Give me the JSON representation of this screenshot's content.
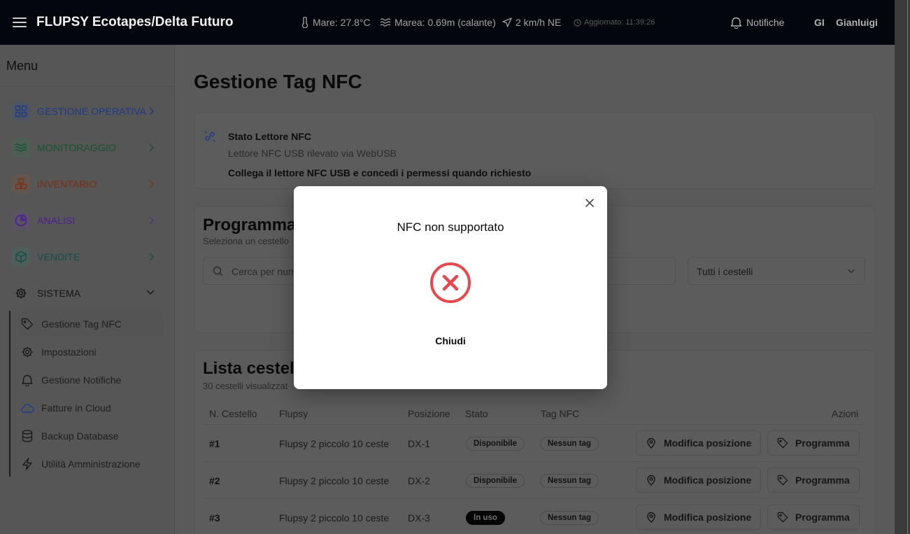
{
  "header": {
    "title": "FLUPSY Ecotapes/Delta Futuro",
    "sea_temp": "Mare: 27.8°C",
    "tide": "Marea: 0.69m (calante)",
    "wind": "2 km/h NE",
    "updated": "Aggiornato: 11:39:26",
    "notifications_label": "Notifiche",
    "user_initials": "GI",
    "user_name": "Gianluigi"
  },
  "sidebar": {
    "title": "Menu",
    "categories": [
      {
        "label": "GESTIONE OPERATIVA",
        "icon": "grid-icon",
        "color": "#1e3a8a",
        "bg": "#4f5662"
      },
      {
        "label": "MONITORAGGIO",
        "icon": "waves-icon",
        "color": "#14532d",
        "bg": "#4f5e55"
      },
      {
        "label": "INVENTARIO",
        "icon": "boxes-icon",
        "color": "#7c2d12",
        "bg": "#625750"
      },
      {
        "label": "ANALISI",
        "icon": "pie-chart-icon",
        "color": "#4c1d95",
        "bg": "#5a5364"
      },
      {
        "label": "VENDITE",
        "icon": "package-icon",
        "color": "#134e4a",
        "bg": "#4f5e5a"
      },
      {
        "label": "SISTEMA",
        "icon": "gear-icon",
        "color": "#151515",
        "bg": "transparent"
      }
    ],
    "sub_items": [
      {
        "label": "Gestione Tag NFC",
        "icon": "tag-icon"
      },
      {
        "label": "Impostazioni",
        "icon": "gear-icon"
      },
      {
        "label": "Gestione Notifiche",
        "icon": "bell-icon"
      },
      {
        "label": "Fatture in Cloud",
        "icon": "cloud-icon"
      },
      {
        "label": "Backup Database",
        "icon": "database-icon"
      },
      {
        "label": "Utilità Amministrazione",
        "icon": "zap-icon"
      }
    ]
  },
  "main": {
    "page_title": "Gestione Tag NFC",
    "nfc_status": {
      "title": "Stato Lettore NFC",
      "subtitle": "Lettore NFC USB rilevato via WebUSB",
      "instruction": "Collega il lettore NFC USB e concedi i permessi quando richiesto"
    },
    "program": {
      "title": "Programma",
      "subtitle": "Seleziona un cestello",
      "search_placeholder": "Cerca per num",
      "filter_value": "Tutti i cestelli"
    },
    "list": {
      "title": "Lista cestelli",
      "subtitle": "30 cestelli visualizzat",
      "columns": [
        "N. Cestello",
        "Flupsy",
        "Posizione",
        "Stato",
        "Tag NFC",
        "Azioni"
      ],
      "rows": [
        {
          "num": "#1",
          "flupsy": "Flupsy 2 piccolo 10 ceste",
          "pos": "DX-1",
          "stato": "Disponibile",
          "tag": "Nessun tag",
          "edit": "Modifica posizione",
          "program": "Programma"
        },
        {
          "num": "#2",
          "flupsy": "Flupsy 2 piccolo 10 ceste",
          "pos": "DX-2",
          "stato": "Disponibile",
          "tag": "Nessun tag",
          "edit": "Modifica posizione",
          "program": "Programma"
        },
        {
          "num": "#3",
          "flupsy": "Flupsy 2 piccolo 10 ceste",
          "pos": "DX-3",
          "stato": "In uso",
          "tag": "Nessun tag",
          "edit": "Modifica posizione",
          "program": "Programma"
        }
      ]
    }
  },
  "modal": {
    "title": "NFC non supportato",
    "button": "Chiudi",
    "error_color": "#e5484d"
  }
}
